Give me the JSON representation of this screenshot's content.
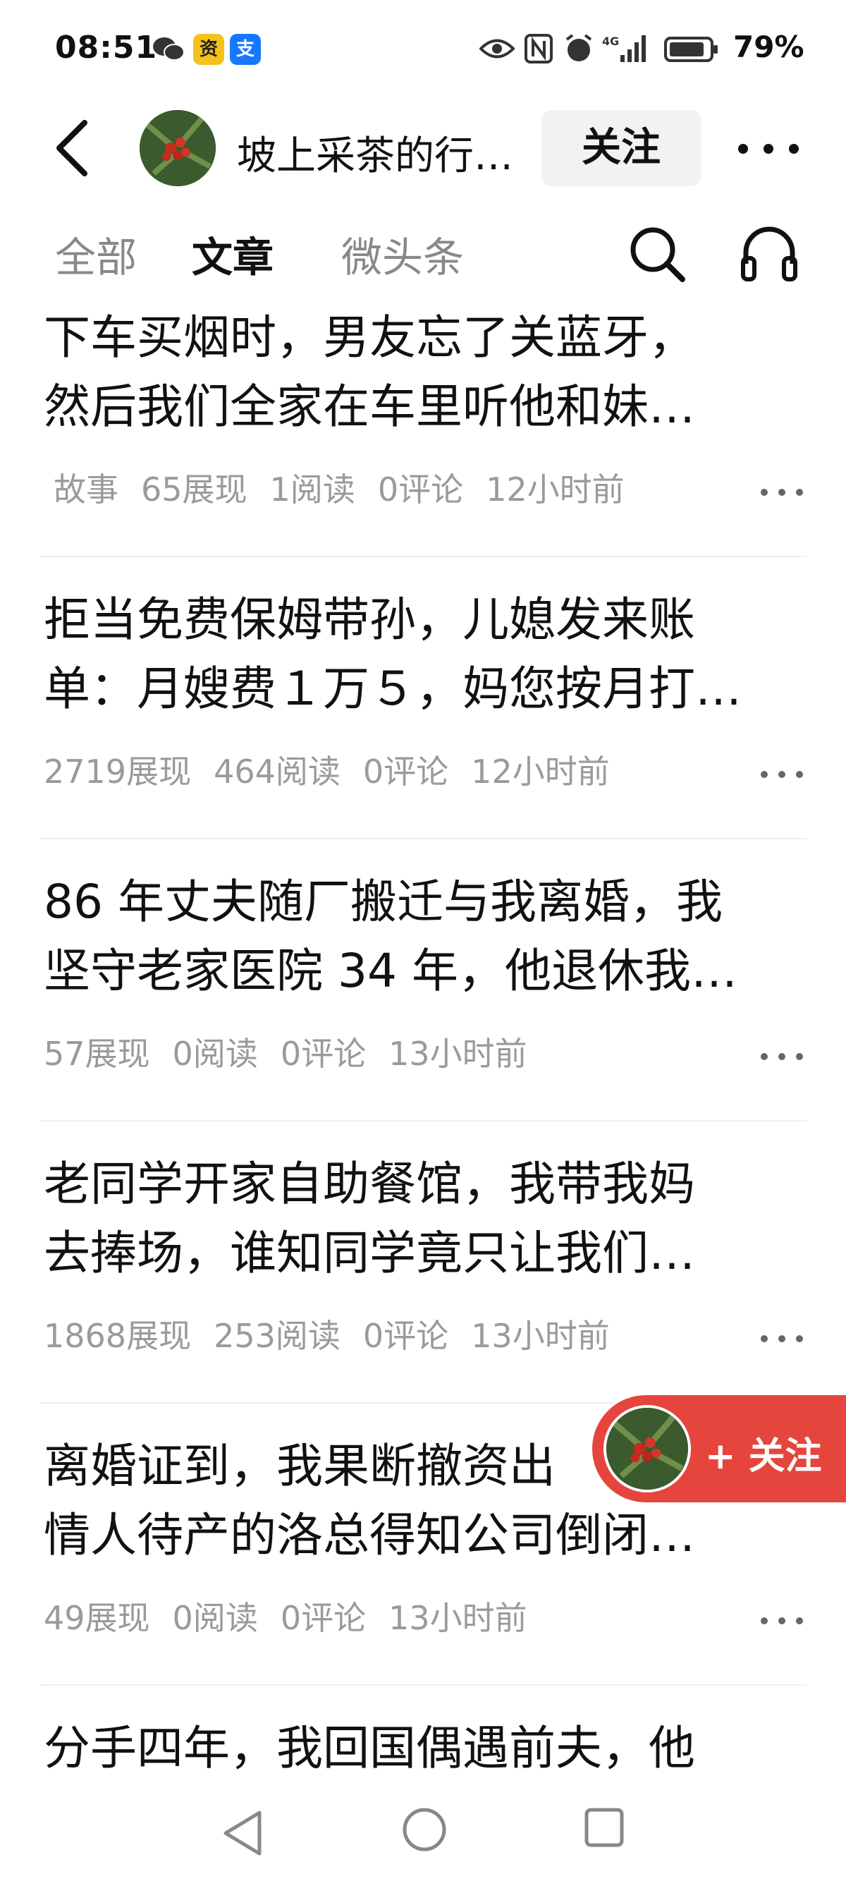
{
  "status_bar": {
    "time": "08:51",
    "app_icon_1": "wechat-icon",
    "app_icon_2_text": "资",
    "app_icon_3_text": "支",
    "network": "4G",
    "battery": "79%"
  },
  "header": {
    "author_name": "坡上采茶的行…",
    "follow_label": "关注"
  },
  "tabs": {
    "all": "全部",
    "articles": "文章",
    "micro": "微头条"
  },
  "articles": [
    {
      "line1": "下车买烟时，男友忘了关蓝牙，",
      "line2": "然后我们全家在车里听他和妹…",
      "tag": "故事",
      "views": "65展现",
      "reads": "1阅读",
      "comments": "0评论",
      "time": "12小时前"
    },
    {
      "line1": "拒当免费保姆带孙，儿媳发来账",
      "line2": "单：月嫂费１万５，妈您按月打…",
      "tag": "",
      "views": "2719展现",
      "reads": "464阅读",
      "comments": "0评论",
      "time": "12小时前"
    },
    {
      "line1": "86 年丈夫随厂搬迁与我离婚，我",
      "line2": "坚守老家医院 34 年，他退休我…",
      "tag": "",
      "views": "57展现",
      "reads": "0阅读",
      "comments": "0评论",
      "time": "13小时前"
    },
    {
      "line1": "老同学开家自助餐馆，我带我妈",
      "line2": "去捧场，谁知同学竟只让我们…",
      "tag": "",
      "views": "1868展现",
      "reads": "253阅读",
      "comments": "0评论",
      "time": "13小时前"
    },
    {
      "line1": "离婚证到，我果断撤资出",
      "line2": "情人待产的洛总得知公司倒闭…",
      "tag": "",
      "views": "49展现",
      "reads": "0阅读",
      "comments": "0评论",
      "time": "13小时前"
    },
    {
      "line1": "分手四年，我回国偶遇前夫，他",
      "line2": "",
      "tag": "",
      "views": "",
      "reads": "",
      "comments": "",
      "time": ""
    }
  ],
  "floating_follow": {
    "label": "+ 关注"
  },
  "colors": {
    "accent_red": "#e5453d",
    "meta_gray": "#9a9a9a",
    "tab_inactive": "#888888"
  }
}
